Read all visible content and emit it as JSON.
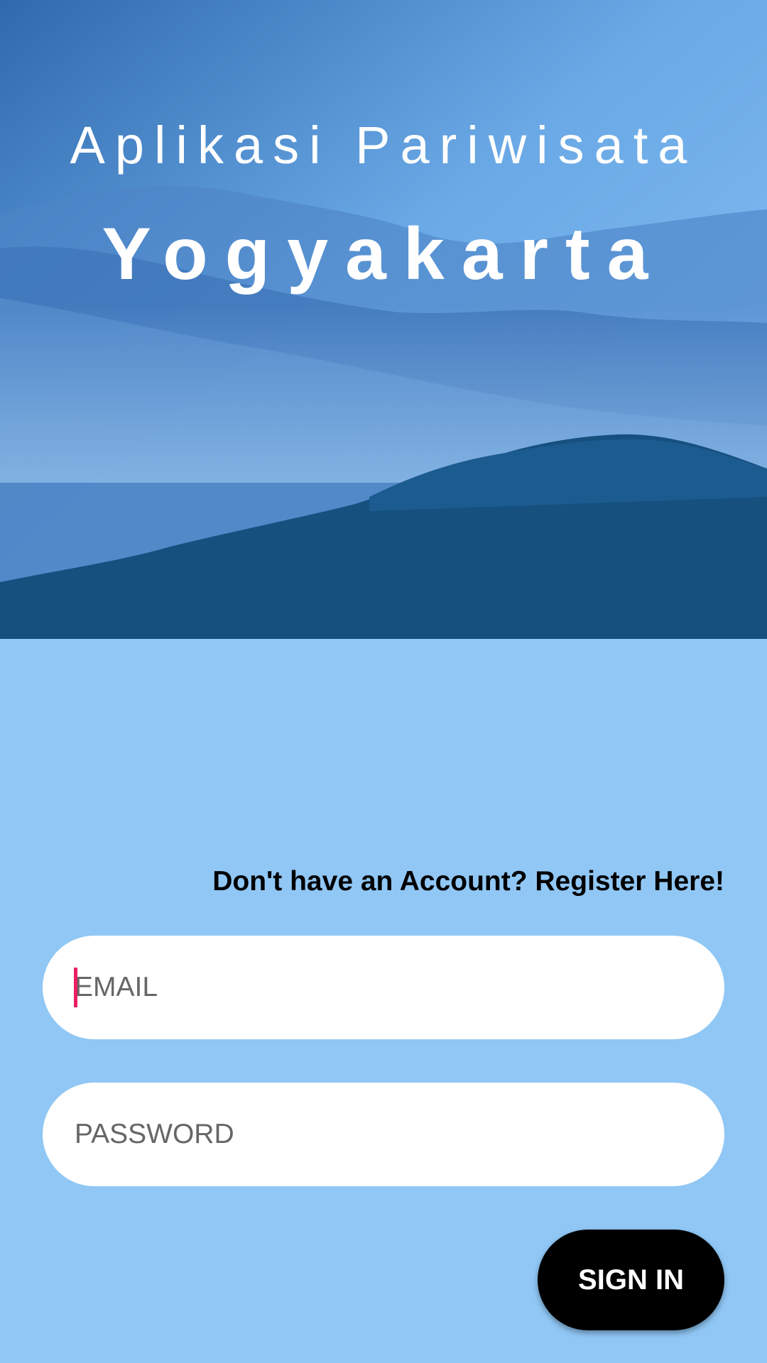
{
  "header": {
    "subtitle": "Aplikasi Pariwisata",
    "title": "Yogyakarta"
  },
  "register": {
    "link_text": "Don't have an Account? Register Here!"
  },
  "form": {
    "email_placeholder": "EMAIL",
    "email_value": "",
    "password_placeholder": "PASSWORD",
    "password_value": "",
    "signin_label": "SIGN IN"
  },
  "colors": {
    "background": "#90c7f5",
    "button": "#000000",
    "caret": "#e91e63"
  }
}
